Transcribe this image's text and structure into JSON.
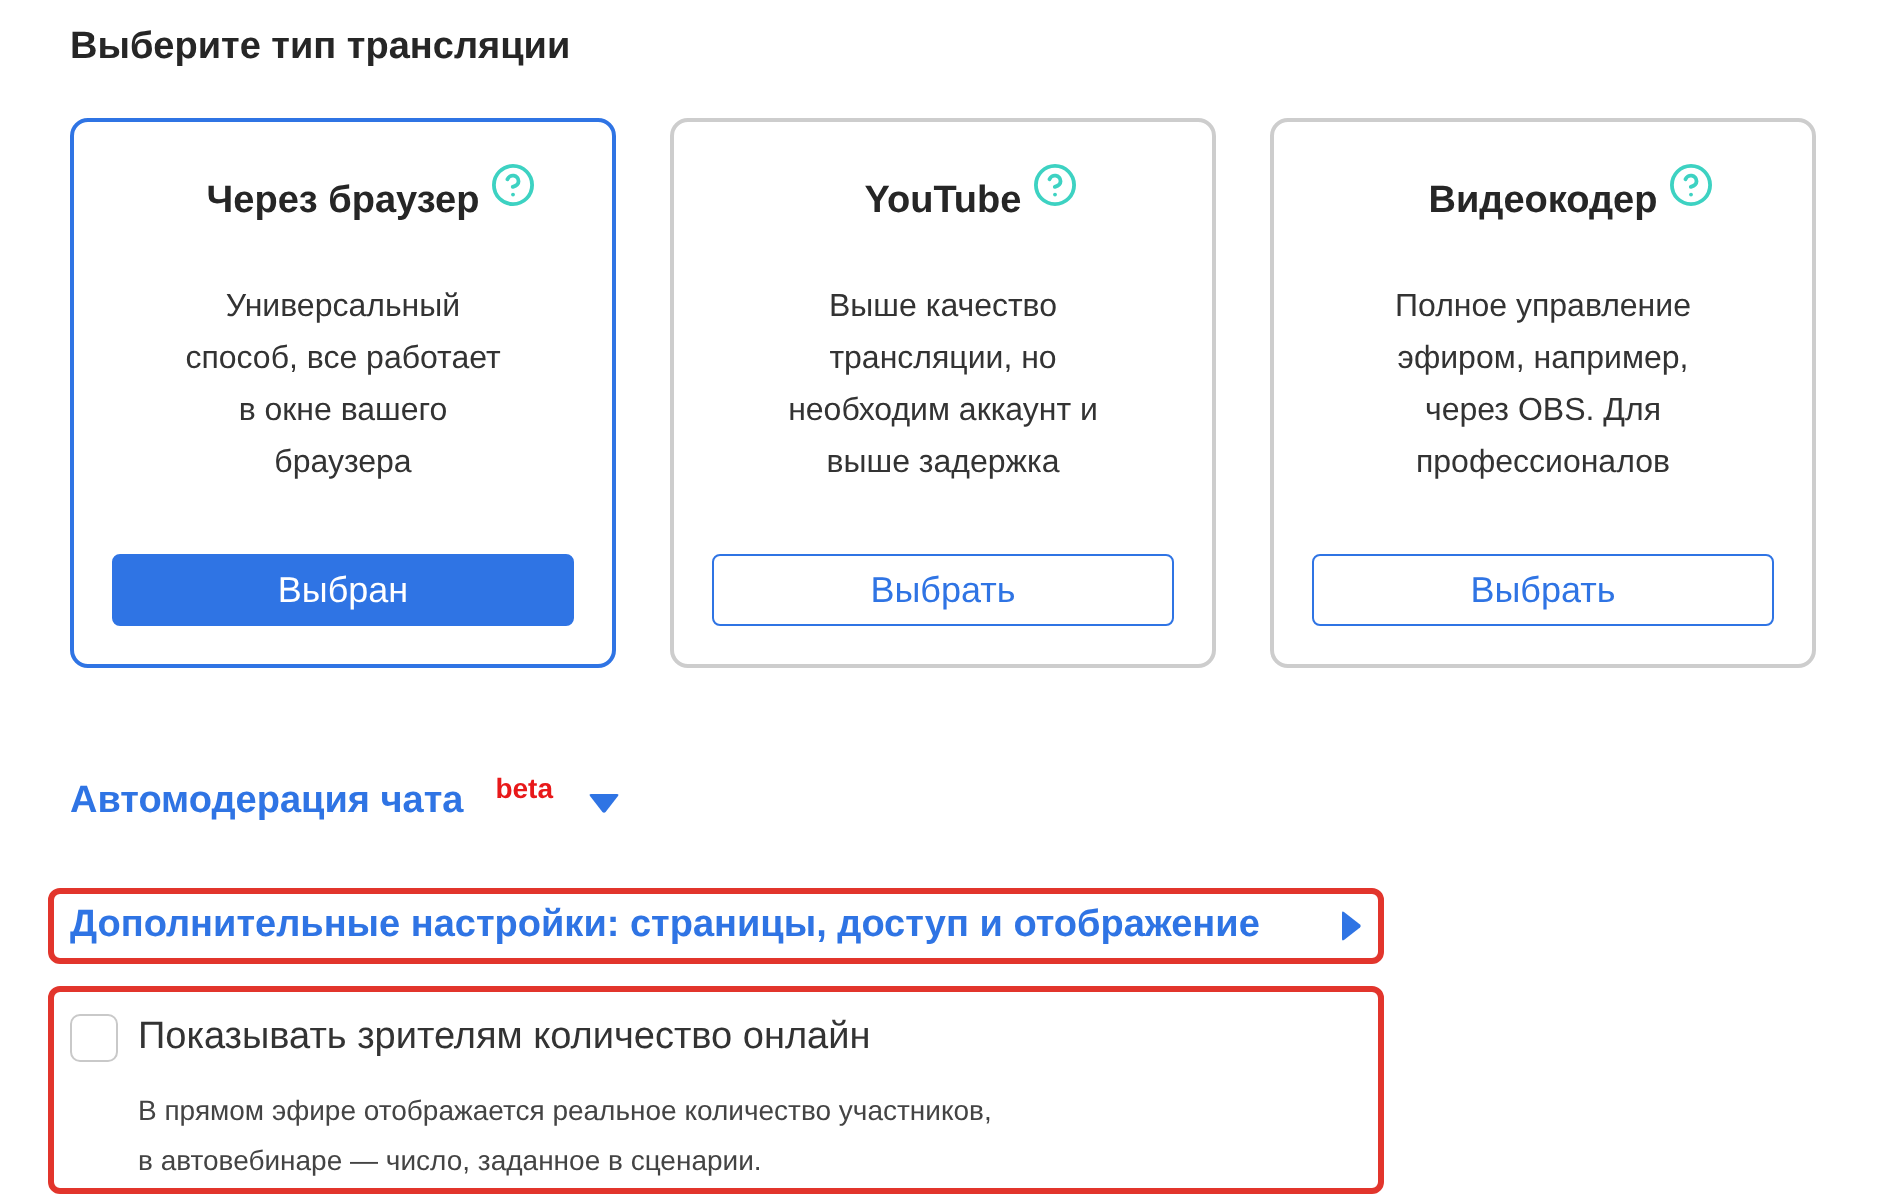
{
  "heading": "Выберите тип трансляции",
  "stream_types": [
    {
      "title": "Через браузер",
      "description": "Универсальный\nспособ, все работает\nв окне вашего\nбраузера",
      "button": "Выбран",
      "selected": true
    },
    {
      "title": "YouTube",
      "description": "Выше качество\nтрансляции, но\nнеобходим аккаунт и\nвыше задержка",
      "button": "Выбрать",
      "selected": false
    },
    {
      "title": "Видеокодер",
      "description": "Полное управление\nэфиром, например,\nчерез OBS. Для\nпрофессионалов",
      "button": "Выбрать",
      "selected": false
    }
  ],
  "sections": [
    {
      "kind": "collapsible",
      "label": "Автомодерация чата",
      "badge": "beta",
      "expanded": true,
      "highlighted": false
    },
    {
      "kind": "collapsible",
      "label": "Дополнительные настройки: страницы, доступ и отображение",
      "expanded": false,
      "highlighted": true
    },
    {
      "kind": "checkbox",
      "label": "Показывать зрителям количество онлайн",
      "checked": false,
      "hint": "В прямом эфире отображается реальное количество участников,\nв автовебинаре — число, заданное в сценарии.",
      "highlighted": true
    }
  ]
}
